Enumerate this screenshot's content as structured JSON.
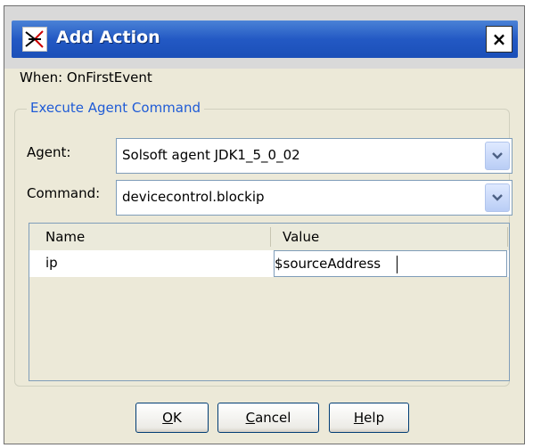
{
  "dialog": {
    "title": "Add Action",
    "close_label": "×"
  },
  "when_label": "When: OnFirstEvent",
  "group": {
    "title": "Execute Agent Command",
    "agent_label": "Agent:",
    "agent_value": "Solsoft agent JDK1_5_0_02",
    "command_label": "Command:",
    "command_value": "devicecontrol.blockip"
  },
  "table": {
    "columns": [
      "Name",
      "Value"
    ],
    "rows": [
      {
        "name": "ip",
        "value": "$sourceAddress"
      }
    ]
  },
  "buttons": {
    "ok_prefix": "",
    "ok_mnemonic": "O",
    "ok_rest": "K",
    "cancel_mnemonic": "C",
    "cancel_rest": "ancel",
    "help_mnemonic": "H",
    "help_rest": "elp"
  },
  "colors": {
    "title_bar": "#2359c4",
    "group_title": "#1f5bd6",
    "dialog_bg": "#ece9d8"
  },
  "icons": [
    "app-logo-icon",
    "close-icon",
    "dropdown-arrow-icon"
  ]
}
